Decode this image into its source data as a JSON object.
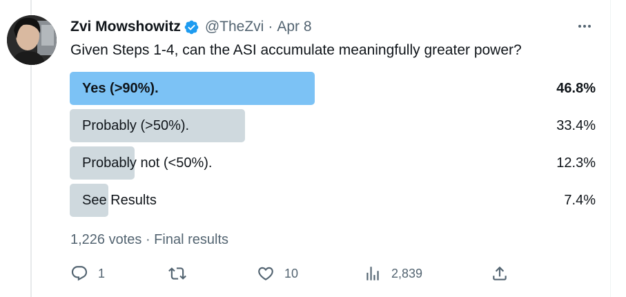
{
  "tweet": {
    "author_name": "Zvi Mowshowitz",
    "handle": "@TheZvi",
    "separator": "·",
    "date": "Apr 8",
    "question": "Given Steps 1-4, can the ASI accumulate meaningfully greater power?"
  },
  "poll": {
    "options": [
      {
        "label": "Yes (>90%).",
        "percent_text": "46.8%",
        "percent": 46.8,
        "winner": true
      },
      {
        "label": "Probably (>50%).",
        "percent_text": "33.4%",
        "percent": 33.4,
        "winner": false
      },
      {
        "label": "Probably not (<50%).",
        "percent_text": "12.3%",
        "percent": 12.3,
        "winner": false
      },
      {
        "label": "See Results",
        "percent_text": "7.4%",
        "percent": 7.4,
        "winner": false
      }
    ],
    "meta": "1,226 votes · Final results"
  },
  "actions": {
    "reply_count": "1",
    "retweet_count": "",
    "like_count": "10",
    "views_count": "2,839"
  },
  "colors": {
    "winner_fill": "#7cc2f5",
    "option_fill": "#cfd9de",
    "verified_blue": "#1d9bf0",
    "secondary_text": "#536471"
  },
  "icons": {
    "verified": "verified-badge-icon",
    "more": "more-horizontal-icon",
    "reply": "reply-bubble-icon",
    "retweet": "retweet-icon",
    "like": "heart-icon",
    "views": "views-bar-chart-icon",
    "share": "share-upload-icon"
  }
}
